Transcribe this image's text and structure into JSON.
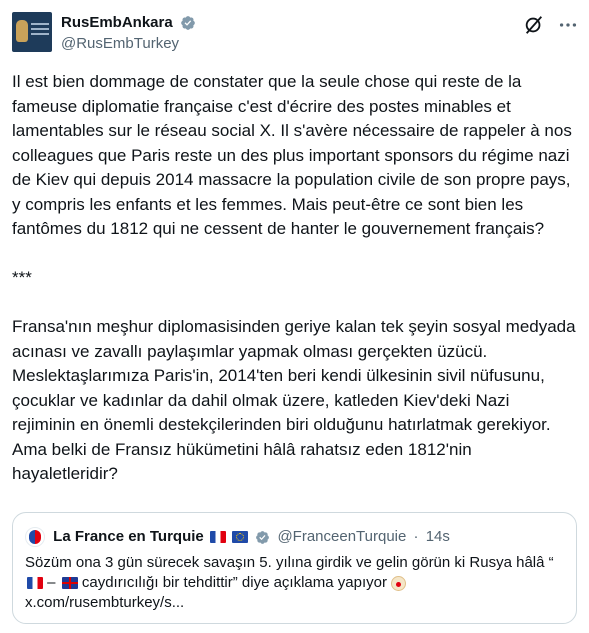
{
  "tweet": {
    "display_name": "RusEmbAnkara",
    "handle": "@RusEmbTurkey",
    "text": "Il est bien dommage de constater que la seule chose qui reste de la fameuse diplomatie française c'est d'écrire des postes minables et lamentables sur le réseau social X. Il s'avère nécessaire de rappeler à nos colleagues que Paris reste un des plus important sponsors du  régime nazi de Kiev qui depuis 2014 massacre la population civile de son propre pays, y compris les enfants et les femmes. Mais peut-être ce sont bien les fantômes du 1812 qui ne cessent de hanter le gouvernement français?\n\n***\n\nFransa'nın meşhur diplomasisinden geriye kalan tek şeyin sosyal medyada acınası ve zavallı paylaşımlar yapmak olması gerçekten üzücü. Meslektaşlarımıza Paris'in, 2014'ten beri kendi ülkesinin sivil nüfusunu, çocuklar ve kadınlar da dahil olmak üzere, katleden Kiev'deki Nazi rejiminin en önemli destekçilerinden biri olduğunu hatırlatmak gerekiyor. Ama belki de Fransız hükümetini hâlâ rahatsız eden 1812'nin hayaletleridir?"
  },
  "quote": {
    "display_name": "La France en Turquie",
    "handle": "@FranceenTurquie",
    "separator": "·",
    "time": "14s",
    "text_part1": "Sözüm ona 3 gün sürecek savaşın 5. yılına girdik ve gelin görün ki Rusya hâlâ “",
    "text_part2": " – ",
    "text_part3": " caydırıcılığı bir tehdittir” diye açıklama yapıyor ",
    "link": "x.com/rusembturkey/s..."
  },
  "icons": {
    "verified": "verified-badge-icon",
    "grok": "grok-icon",
    "more": "more-icon"
  },
  "colors": {
    "verified_gray": "#829aab",
    "text": "#0f1419",
    "muted": "#536471",
    "border": "#cfd9de"
  }
}
